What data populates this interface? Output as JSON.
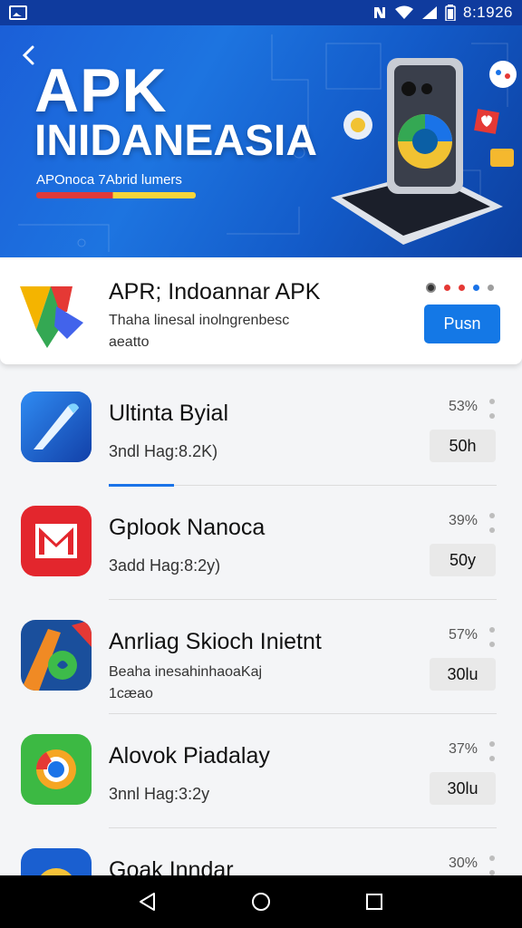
{
  "status_bar": {
    "time": "8:1926",
    "icons": [
      "image-icon",
      "nfc-icon",
      "wifi-icon",
      "signal-icon",
      "battery-icon"
    ]
  },
  "hero": {
    "title_line1": "APK",
    "title_line2": "INIDANEASIA",
    "subtitle": "APOnoca 7Abrid lumers",
    "accent_colors": [
      "#e03a3a",
      "#f5d53a"
    ]
  },
  "featured": {
    "title": "APR; Indoannar APK",
    "description_line1": "Thaha linesal inolngrenbesc",
    "description_line2": "aeatto",
    "button_label": "Pusn",
    "dot_colors": [
      "#333333",
      "#e53935",
      "#e53935",
      "#1a73e8",
      "#9e9e9e"
    ],
    "button_color": "#1478e6"
  },
  "apps": [
    {
      "name": "Ultinta Byial",
      "meta": "3ndl Hag:8.2K)",
      "percent": "53%",
      "size": "50h",
      "icon": "pen-stylus-icon"
    },
    {
      "name": "Gplook Nanoca",
      "meta": "3add Hag:8:2y)",
      "percent": "39%",
      "size": "50y",
      "icon": "mail-logo-icon"
    },
    {
      "name": "Anrliag Skioch Inietnt",
      "meta_line1": "Beaha inesahinhaoaKaj",
      "meta_line2": "1cæao",
      "percent": "57%",
      "size": "30lu",
      "icon": "art-brush-icon"
    },
    {
      "name": "Alovok Piadalay",
      "meta": "3nnl Hag:3:2y",
      "percent": "37%",
      "size": "30lu",
      "icon": "chrome-like-icon"
    },
    {
      "name": "Goak Inndar",
      "meta": "",
      "percent": "30%",
      "size": "",
      "icon": "globe-app-icon"
    }
  ],
  "nav": {
    "icons": [
      "back-triangle-icon",
      "home-circle-icon",
      "recents-square-icon"
    ]
  }
}
